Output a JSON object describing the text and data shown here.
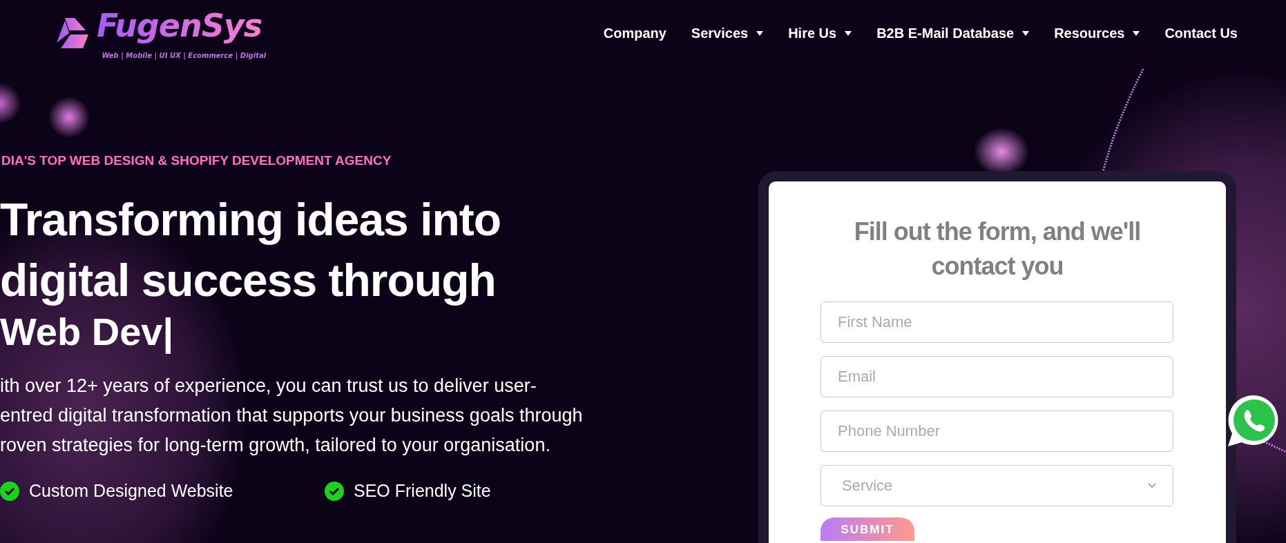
{
  "header": {
    "logo": {
      "name": "FugenSys",
      "tagline": "Web | Mobile | UI UX | Ecommerce | Digital"
    },
    "nav": [
      {
        "label": "Company",
        "dropdown": false
      },
      {
        "label": "Services",
        "dropdown": true
      },
      {
        "label": "Hire Us",
        "dropdown": true
      },
      {
        "label": "B2B E-Mail Database",
        "dropdown": true
      },
      {
        "label": "Resources",
        "dropdown": true
      },
      {
        "label": "Contact Us",
        "dropdown": false
      }
    ]
  },
  "hero": {
    "eyebrow": "DIA'S TOP WEB DESIGN & SHOPIFY DEVELOPMENT AGENCY",
    "headline": [
      "Transforming ideas into",
      "digital success through"
    ],
    "typed": "Web Dev|",
    "description": [
      "ith over 12+ years of experience, you can trust us to deliver user-",
      "entred digital transformation that supports your business goals through",
      "roven strategies for long-term growth, tailored to your organisation."
    ],
    "features": [
      {
        "label": "Custom Designed Website"
      },
      {
        "label": "SEO Friendly Site"
      }
    ]
  },
  "form": {
    "title": "Fill out the form, and we'll contact you",
    "fields": [
      {
        "kind": "text",
        "placeholder": "First Name"
      },
      {
        "kind": "text",
        "placeholder": "Email"
      },
      {
        "kind": "text",
        "placeholder": "Phone Number"
      },
      {
        "kind": "select",
        "placeholder": "Service"
      }
    ],
    "submit": "SUBMIT"
  }
}
